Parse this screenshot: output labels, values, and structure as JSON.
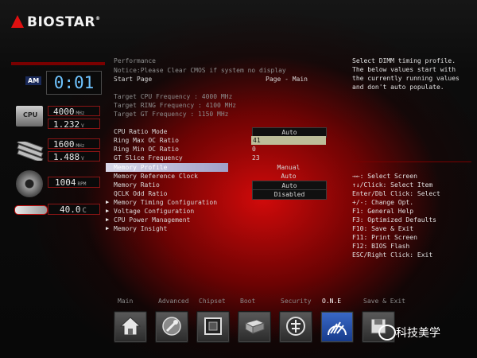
{
  "brand": {
    "name": "BIOSTAR",
    "tm": "®"
  },
  "monitors": {
    "clock": {
      "tag": "AM",
      "time": "0:01"
    },
    "cpu": {
      "tag": "CPU",
      "freq": "4000",
      "freq_unit": "MHz",
      "volt": "1.232",
      "volt_unit": "V"
    },
    "memory": {
      "freq": "1600",
      "freq_unit": "MHz",
      "volt": "1.488",
      "volt_unit": "V"
    },
    "fan": {
      "rpm": "1004",
      "rpm_unit": "RPM"
    },
    "temp": {
      "value": "40.0",
      "unit": "C"
    }
  },
  "main": {
    "header1": "Performance",
    "header2": "Notice:Please Clear CMOS if system no display",
    "start_page_label": "Start Page",
    "start_page_value": "Page - Main",
    "target_cpu": "Target CPU Frequency : 4000 MHz",
    "target_ring": "Target RING Frequency : 4100 MHz",
    "target_gt": "Target GT Frequency : 1150 MHz",
    "items": [
      {
        "label": "CPU Ratio Mode",
        "value": "Auto"
      },
      {
        "label": "Ring Max OC Ratio",
        "value": "41"
      },
      {
        "label": "Ring Min OC Ratio",
        "value": "0"
      },
      {
        "label": "GT Slice Frequency",
        "value": "23"
      },
      {
        "label": "Memory Profile",
        "value": "Manual"
      },
      {
        "label": "Memory Reference Clock",
        "value": "Auto"
      },
      {
        "label": "Memory Ratio",
        "value": "Auto"
      },
      {
        "label": "QCLK Odd Ratio",
        "value": "Disabled"
      }
    ],
    "submenus": [
      "Memory Timing Configuration",
      "Voltage Configuration",
      "CPU Power Management",
      "Memory Insight"
    ]
  },
  "help": {
    "description": [
      "Select DIMM timing profile.",
      "The below values start with",
      "the currently running values",
      "and don't auto populate."
    ],
    "keys": [
      "→←: Select Screen",
      "↑↓/Click: Select Item",
      "Enter/Dbl Click: Select",
      "+/-: Change Opt.",
      "F1: General Help",
      "F3: Optimized Defaults",
      "F10: Save & Exit",
      "F11: Print Screen",
      "F12: BIOS Flash",
      "ESC/Right Click: Exit"
    ]
  },
  "nav": {
    "tabs": [
      "Main",
      "Advanced",
      "Chipset",
      "Boot",
      "Security",
      "O.N.E",
      "Save & Exit"
    ],
    "active": "O.N.E"
  },
  "watermark": "科技美学"
}
